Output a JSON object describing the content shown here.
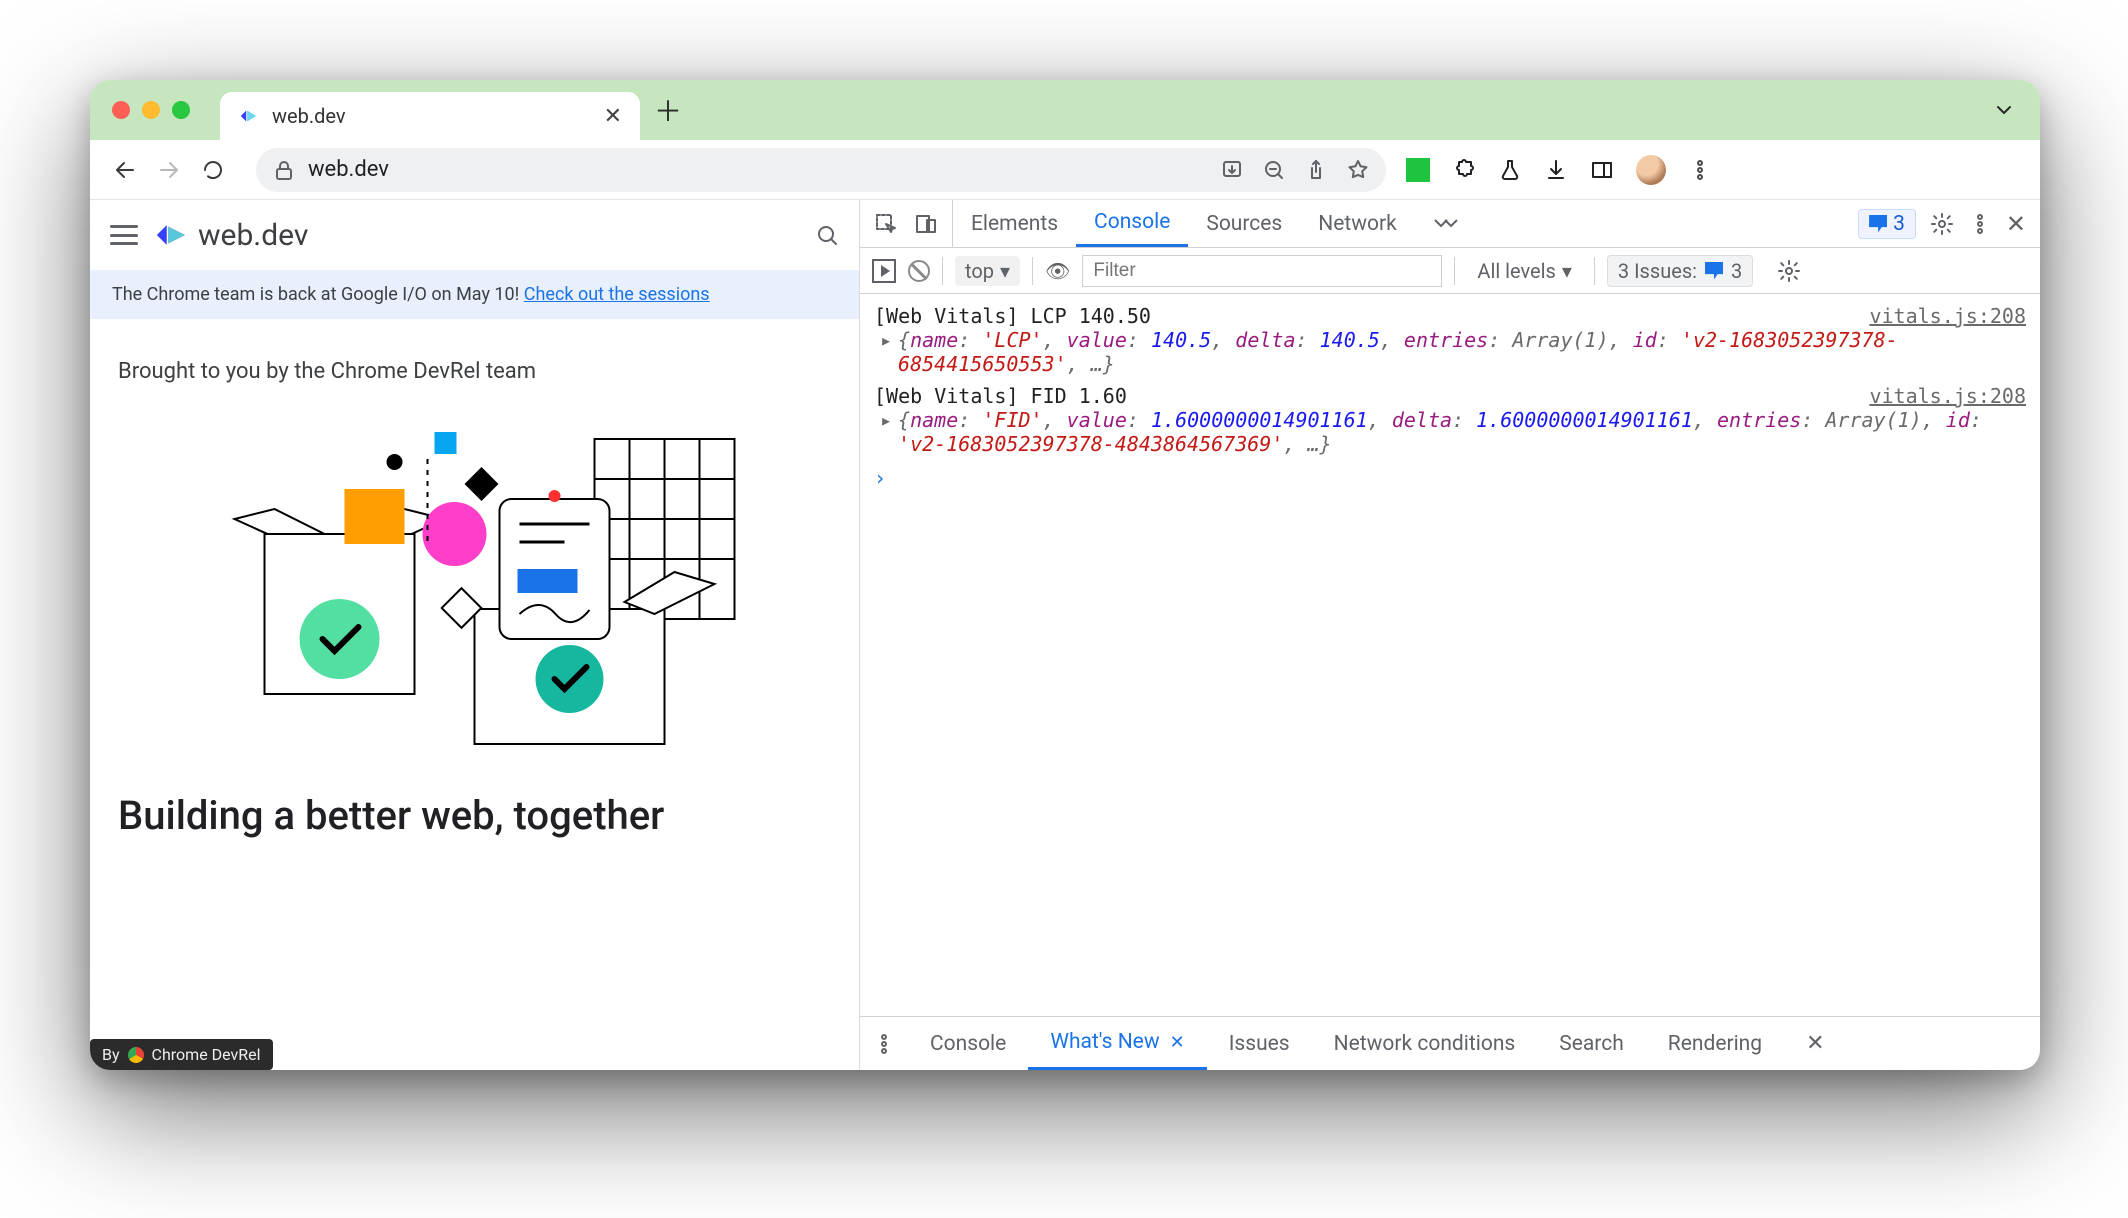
{
  "chrome": {
    "tab_title": "web.dev",
    "url": "web.dev"
  },
  "page": {
    "brand": "web.dev",
    "banner_text": "The Chrome team is back at Google I/O on May 10! ",
    "banner_link": "Check out the sessions",
    "subheading": "Brought to you by the Chrome DevRel team",
    "headline": "Building a better web, together",
    "credit_prefix": "By",
    "credit_label": "Chrome DevRel"
  },
  "devtools": {
    "tabs": {
      "elements": "Elements",
      "console": "Console",
      "sources": "Sources",
      "network": "Network"
    },
    "msg_count": "3",
    "context": "top",
    "filter_placeholder": "Filter",
    "levels": "All levels",
    "issues_label": "3 Issues:",
    "issues_count": "3",
    "logs": [
      {
        "title": "[Web Vitals] LCP 140.50",
        "src": "vitals.js:208",
        "obj": {
          "name": "'LCP'",
          "value": "140.5",
          "delta": "140.5",
          "entries": "Array(1)",
          "id": "'v2-1683052397378-6854415650553'"
        }
      },
      {
        "title": "[Web Vitals] FID 1.60",
        "src": "vitals.js:208",
        "obj": {
          "name": "'FID'",
          "value": "1.6000000014901161",
          "delta": "1.6000000014901161",
          "entries": "Array(1)",
          "id": "'v2-1683052397378-4843864567369'"
        }
      }
    ],
    "drawer": {
      "console": "Console",
      "whatsnew": "What's New",
      "issues": "Issues",
      "netcond": "Network conditions",
      "search": "Search",
      "rendering": "Rendering"
    }
  }
}
